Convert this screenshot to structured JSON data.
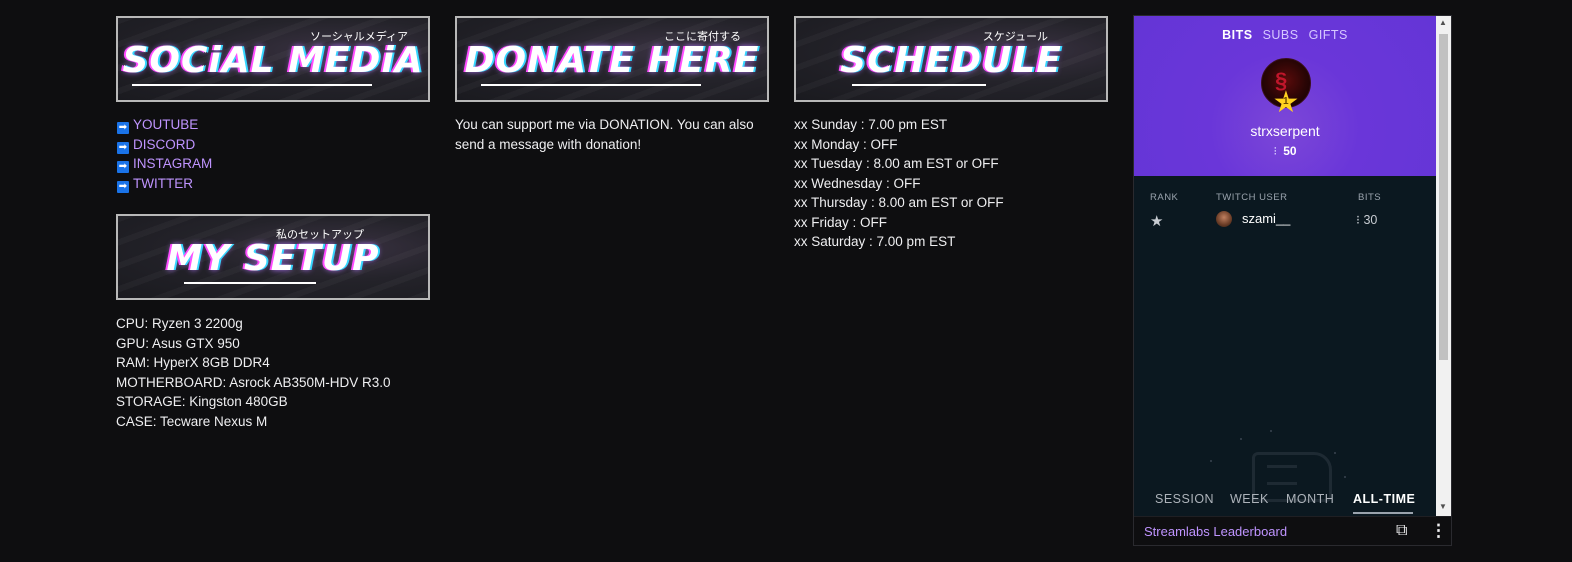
{
  "panels": {
    "social": {
      "banner_title": "SOCiAL MEDiA",
      "banner_jp": "ソーシャルメディア",
      "links": [
        "YOUTUBE",
        "DISCORD",
        "INSTAGRAM",
        "TWITTER"
      ],
      "arrow_glyph": "➡"
    },
    "setup": {
      "banner_title": "MY SETUP",
      "banner_jp": "私のセットアップ",
      "lines": [
        "CPU: Ryzen 3 2200g",
        "GPU: Asus GTX 950",
        "RAM: HyperX 8GB DDR4",
        "MOTHERBOARD: Asrock AB350M-HDV R3.0",
        "STORAGE: Kingston 480GB",
        "CASE: Tecware Nexus M"
      ]
    },
    "donate": {
      "banner_title": "DONATE HERE",
      "banner_jp": "ここに寄付する",
      "text_line1": "You can support me via DONATION. You can also",
      "text_line2": "send a message with donation!"
    },
    "schedule": {
      "banner_title": "SCHEDULE",
      "banner_jp": "スケジュール",
      "lines": [
        "xx Sunday : 7.00 pm EST",
        "xx Monday : OFF",
        "xx Tuesday : 8.00 am EST or OFF",
        "xx Wednesday : OFF",
        "xx Thursday : 8.00 am EST or OFF",
        "xx Friday : OFF",
        "xx Saturday : 7.00 pm EST"
      ]
    }
  },
  "leaderboard": {
    "tabs": [
      "BITS",
      "SUBS",
      "GIFTS"
    ],
    "active_tab": "BITS",
    "top_user": {
      "name": "strxserpent",
      "score": "50",
      "rank_badge": "1"
    },
    "headers": {
      "rank": "RANK",
      "user": "TWITCH USER",
      "bits": "BITS"
    },
    "rows": [
      {
        "rank_icon": "★",
        "user": "szami__",
        "bits": "30"
      }
    ],
    "periods": [
      "SESSION",
      "WEEK",
      "MONTH",
      "ALL-TIME"
    ],
    "active_period": "ALL-TIME",
    "footer_title": "Streamlabs Leaderboard",
    "popout_glyph": "⧉",
    "menu_glyph": "⋮"
  },
  "colors": {
    "background": "#0e0e10",
    "link": "#bf94ff",
    "leaderboard_purple": "#6435d6"
  }
}
